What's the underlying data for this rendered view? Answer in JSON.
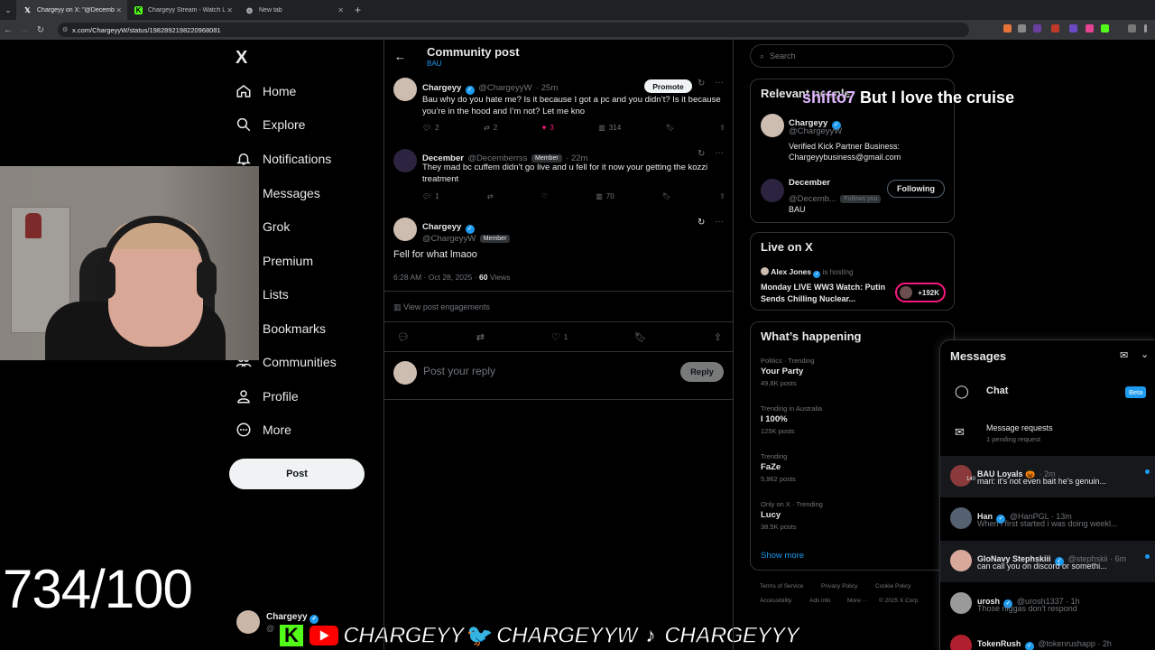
{
  "browser": {
    "tabs": [
      {
        "label": "Chargeyy on X: \"@Decemberr...",
        "favicon": "X",
        "active": true
      },
      {
        "label": "Chargeyy Stream - Watch Live",
        "favicon": "K",
        "active": false
      },
      {
        "label": "New tab",
        "favicon": "globe",
        "active": false
      }
    ],
    "url": "x.com/ChargeyyW/status/1982892198220968081",
    "new_tab_symbol": "+"
  },
  "nav": {
    "logo": "X",
    "items": [
      {
        "label": "Home",
        "icon": "home-icon"
      },
      {
        "label": "Explore",
        "icon": "search-icon"
      },
      {
        "label": "Notifications",
        "icon": "bell-icon"
      },
      {
        "label": "Messages",
        "icon": "mail-icon"
      },
      {
        "label": "Grok",
        "icon": "grok-icon"
      },
      {
        "label": "Premium",
        "icon": "x-premium-icon"
      },
      {
        "label": "Lists",
        "icon": "list-icon"
      },
      {
        "label": "Bookmarks",
        "icon": "bookmark-icon"
      },
      {
        "label": "Communities",
        "icon": "communities-icon"
      },
      {
        "label": "Profile",
        "icon": "person-icon"
      },
      {
        "label": "More",
        "icon": "more-circle-icon"
      }
    ],
    "post_button": "Post",
    "account": {
      "name": "Chargeyy",
      "handle": "@"
    }
  },
  "stream_overlay": {
    "counter": "734/100",
    "chat_user": "shifto7",
    "chat_message": "But I love the cruise",
    "banner": [
      "CHARGEYY",
      "CHARGEYYW",
      "CHARGEYYY"
    ]
  },
  "main": {
    "header_title": "Community post",
    "header_sub": "BAU",
    "tweet1": {
      "name": "Chargeyy",
      "handle": "@ChargeyyW",
      "time": "· 25m",
      "promote": "Promote",
      "text": "Bau why do you hate me? Is it because I got a pc and you didn’t? Is it because you’re in the hood and I’m not? Let me kno",
      "replies": "2",
      "reposts": "2",
      "likes": "3",
      "views": "314"
    },
    "tweet2": {
      "name": "December",
      "handle": "@Decemberrss",
      "badge": "Member",
      "time": "· 22m",
      "text": "They mad bc cuffem didn’t go live and u fell for it now your getting the kozzi treatment",
      "replies": "1",
      "reposts": "",
      "likes": "",
      "views": "70"
    },
    "tweet3": {
      "name": "Chargeyy",
      "handle": "@ChargeyyW",
      "badge": "Member",
      "text": "Fell for what lmaoo",
      "timestamp": "6:28 AM · Oct 28, 2025 ·",
      "views_count": "60",
      "views_label": "Views",
      "engagements": "View post engagements",
      "likes": "1"
    },
    "reply_placeholder": "Post your reply",
    "reply_button": "Reply"
  },
  "sidebar": {
    "search_placeholder": "Search",
    "relevant_title": "Relevant people",
    "people": [
      {
        "name": "Chargeyy",
        "handle": "@ChargeyyW",
        "bio": "Verified Kick Partner Business: Chargeyybusiness@gmail.com"
      },
      {
        "name": "December",
        "handle": "@Decemb...",
        "follows_you": "Follows you",
        "bio": "BAU",
        "button": "Following"
      }
    ],
    "live_title": "Live on X",
    "live": {
      "host": "Alex Jones",
      "hosting": "is hosting",
      "title": "Monday LIVE WW3 Watch: Putin Sends Chilling Nuclear...",
      "count": "+192K"
    },
    "happening_title": "What’s happening",
    "trends": [
      {
        "meta": "Politics · Trending",
        "name": "Your Party",
        "count": "49.8K posts"
      },
      {
        "meta": "Trending in Australia",
        "name": "I 100%",
        "count": "125K posts"
      },
      {
        "meta": "Trending",
        "name": "FaZe",
        "count": "5,962 posts"
      },
      {
        "meta": "Only on X · Trending",
        "name": "Lucy",
        "count": "38.5K posts"
      }
    ],
    "show_more": "Show more",
    "footer": [
      "Terms of Service",
      "Privacy Policy",
      "Cookie Policy",
      "Accessibility",
      "Ads info",
      "More ···",
      "© 2025 X Corp."
    ]
  },
  "messages": {
    "title": "Messages",
    "chat": "Chat",
    "beta": "Beta",
    "requests_title": "Message requests",
    "requests_sub": "1 pending request",
    "dms": [
      {
        "name": "BAU Loyals 🎃",
        "meta": "· 2m",
        "text": "mari: it's not even bait he's genuin...",
        "unread": true,
        "badge": "140"
      },
      {
        "name": "Han",
        "meta": "@HanPGL · 13m",
        "text": "When i first started i was doing weekl...",
        "unread": false
      },
      {
        "name": "GloNavy Stephskiii",
        "meta": "@stephskii · 6m",
        "text": "can call you on discord or somethi...",
        "unread": true
      },
      {
        "name": "urosh",
        "meta": "@urosh1337 · 1h",
        "text": "Those niggas don't respond",
        "unread": false
      },
      {
        "name": "TokenRush",
        "meta": "@tokenrushapp · 2h",
        "text": "",
        "unread": false
      }
    ]
  }
}
